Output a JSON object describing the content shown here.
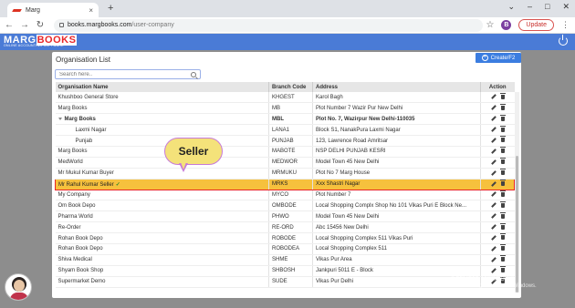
{
  "browser": {
    "tab_title": "Marg",
    "tab_close": "×",
    "new_tab": "+",
    "url_domain": "books.margbooks.com",
    "url_path": "/user-company",
    "profile_initial": "B",
    "update_label": "Update",
    "kebab": "⋮",
    "minimize": "⌄",
    "min2": "–",
    "restore": "□",
    "close": "✕"
  },
  "app": {
    "logo_text_1": "MARG",
    "logo_text_2": "BOOKS",
    "logo_tagline": "ONLINE ACCOUNTING SOFTWARE"
  },
  "panel": {
    "title": "Organisation List",
    "create_label": "Create/F2",
    "search_placeholder": "Search here..",
    "columns": [
      "Organisation Name",
      "Branch Code",
      "Address",
      "Action"
    ]
  },
  "rows": [
    {
      "name": "Khushboo General Store",
      "code": "KHGEST",
      "address": "Karol Bagh"
    },
    {
      "name": "Marg Books",
      "code": "MB",
      "address": "Plot Number 7 Wazir Pur New Delhi"
    },
    {
      "name": "Marg Books",
      "code": "MBL",
      "address": "Plot No. 7, Wazirpur New Delhi-110035"
    },
    {
      "name": "Laxmi Nagar",
      "code": "LANA1",
      "address": "Block S1, NanakPura Laxmi Nagar"
    },
    {
      "name": "Punjab",
      "code": "PUNJAB",
      "address": "123, Lawrence Road Amritsar"
    },
    {
      "name": "Marg Books",
      "code": "MABOTE",
      "address": "NSP DELHI PUNJAB KESRI"
    },
    {
      "name": "MedWorld",
      "code": "MEDWOR",
      "address": "Model Town 45 New Delhi"
    },
    {
      "name": "Mr Mukul Kumar Buyer",
      "code": "MRMUKU",
      "address": "Plot No 7 Marg House"
    },
    {
      "name": "Mr Rahul Kumar Seller",
      "code": "MRKS",
      "address": "Xxx Shastri Nagar"
    },
    {
      "name": "My Company",
      "code": "MYCO",
      "address": "Plot Number 7"
    },
    {
      "name": "Om Book Depo",
      "code": "OMBODE",
      "address": "Local Shopping Complx Shop No 101 Vikas Puri E Block Ne..."
    },
    {
      "name": "Pharma World",
      "code": "PHWO",
      "address": "Model Town 45 New Delhi"
    },
    {
      "name": "Re-Order",
      "code": "RE-ORD",
      "address": "Abc 15456 New Delhi"
    },
    {
      "name": "Rohan Book Depo",
      "code": "ROBODE",
      "address": "Local Shopping Complex 511 Vikas Puri"
    },
    {
      "name": "Rohan Book Depo",
      "code": "ROBODEA",
      "address": "Local Shopping Complex 511"
    },
    {
      "name": "Shiva Medical",
      "code": "SHME",
      "address": "Vikas Pur Area"
    },
    {
      "name": "Shyam Book Shop",
      "code": "SHBOSH",
      "address": "Jankpuri 5011 E - Block"
    },
    {
      "name": "Supermarket Demo",
      "code": "SUDE",
      "address": "Vikas Pur Delhi"
    }
  ],
  "callout": {
    "text": "Seller"
  },
  "check_mark": "✓",
  "watermark": {
    "line1": "Activate Windows",
    "line2": "Go to Settings to activate Windows."
  }
}
